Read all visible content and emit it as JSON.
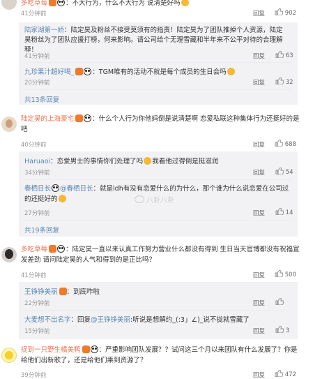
{
  "top": {
    "name": "多吃草莓",
    "text": "：不大行为，什么不大行为 说清楚好吗",
    "time": "41分钟前",
    "reply": "回复",
    "likes": "902"
  },
  "replies1": [
    {
      "name": "陆家湖第一娇",
      "text": "：陆定昊及粉丝不接受莫须有的指责！陆定昊为了团队推掉个人资源，陆定昊粉丝为了团队应援打榜，何来影响。请公司给个无理雪藏和半年来不公平对待的合理解释！",
      "time": "41分钟前",
      "reply": "回复",
      "likes": "63"
    },
    {
      "name": "九珍果汁超好喝_",
      "text": "：TGM唯有的活动不就是每个成员的生日会吗",
      "time": "20分钟前",
      "reply": "回复",
      "likes": "32"
    }
  ],
  "more1": "共13条回复",
  "c2": {
    "name": "陆定昊的上海豪宅",
    "text": "：什么个人行为你他妈倒是说清楚啊 恋爱私联这种集体行为还挺好的是吧",
    "time": "40分钟前",
    "reply": "回复",
    "likes": "688"
  },
  "replies2": [
    {
      "name": "Haruaoi",
      "text": "：恋爱男士的事情你们处理了吗",
      "text2": "我看他过得倒是挺滋润",
      "time": "34分钟前",
      "reply": "回复",
      "likes": "54"
    },
    {
      "name": "春栖日长",
      "mention": "@春栖日长",
      "text": "：就是ldh有没有恋爱什么的为什么，那个谁为什么说恋爱在公司过的还挺好的",
      "time": "27分钟前",
      "reply": "回复",
      "likes": "14"
    }
  ],
  "watermark": "八卦八卦",
  "more2": "共19条回复",
  "c3": {
    "name": "多吃草莓",
    "text": "：陆定昊一直以来认真工作努力营业什么都没有得到 生日当天官博都没有祝福宣发差劲 请问陆定昊的人气和得到的是正比吗？",
    "time": "41分钟前",
    "reply": "回复",
    "likes": "500"
  },
  "replies3": [
    {
      "name": "王铮铮美丽",
      "text": "：到底咋啦",
      "time": "22分钟前",
      "reply": "回复",
      "likes": ""
    },
    {
      "name": "大麦想不出名字",
      "text": "：回复",
      "mention": "@王铮铮美丽",
      "text2": ":听说是想解约_(:3」∠)_说不拢就雪藏了",
      "time": "15分钟前",
      "reply": "回复",
      "likes": "3"
    }
  ],
  "c4": {
    "name": "捉到一只野生橘美鸭",
    "text": "：严重影响团队发展？？试问这三个月以来团队有什么发展了？你是给他们出新歌了，还是给他们乘到资源了？",
    "time": "39分钟前",
    "reply": "回复",
    "likes": "472"
  }
}
